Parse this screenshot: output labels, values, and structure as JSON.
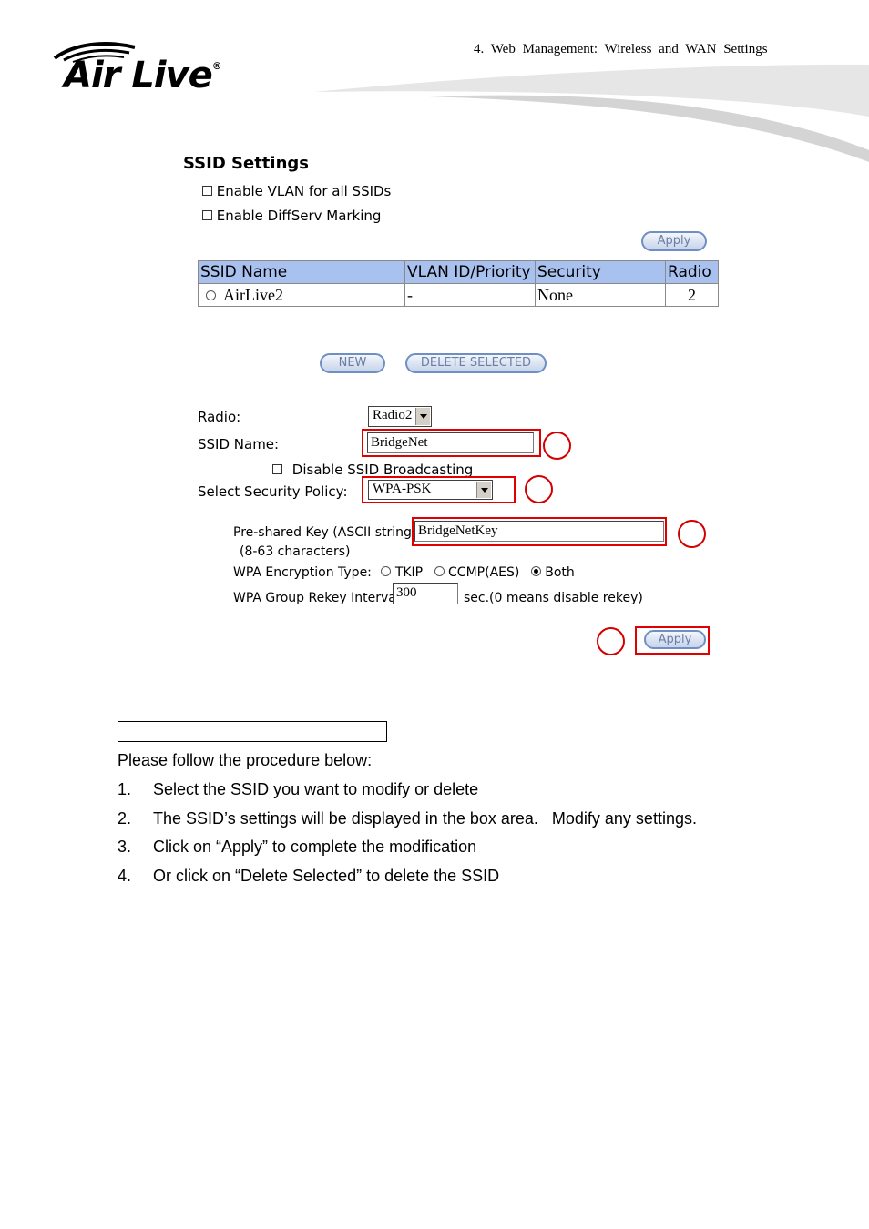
{
  "header": {
    "chapter": "4. Web Management: Wireless and WAN Settings",
    "logo": "Air Live",
    "logo_reg": "®"
  },
  "ssid_settings": {
    "title": "SSID Settings",
    "enable_vlan_label": "Enable VLAN for all SSIDs",
    "enable_diffserv_label": "Enable DiffServ Marking",
    "apply_label": "Apply",
    "table": {
      "headers": [
        "SSID  Name",
        "VLAN ID/Priority",
        "Security",
        "Radio"
      ],
      "rows": [
        {
          "name": "AirLive2",
          "vlan": "-",
          "security": "None",
          "radio": "2"
        }
      ]
    },
    "new_label": "NEW",
    "delete_label": "DELETE SELECTED"
  },
  "form": {
    "radio_label": "Radio:",
    "radio_value": "Radio2",
    "ssid_name_label": "SSID Name:",
    "ssid_name_value": "BridgeNet",
    "disable_broadcast_label": "Disable SSID Broadcasting",
    "security_policy_label": "Select Security Policy:",
    "security_policy_value": "WPA-PSK",
    "psk_label": "Pre-shared Key (ASCII string):",
    "psk_hint": "(8-63 characters)",
    "psk_value": "BridgeNetKey",
    "wpa_enc_label": "WPA Encryption Type:",
    "wpa_enc_options": [
      "TKIP",
      "CCMP(AES)",
      "Both"
    ],
    "wpa_enc_selected": "Both",
    "rekey_label": "WPA Group Rekey Interval:",
    "rekey_value": "300",
    "rekey_suffix": "sec.(0 means disable rekey)",
    "apply_label": "Apply"
  },
  "doc": {
    "intro": "Please follow the procedure below:",
    "steps": [
      {
        "num": "1.",
        "text": "Select the SSID you want to modify or delete"
      },
      {
        "num": "2.",
        "text": "The SSID’s settings will be displayed in the box area.   Modify any settings."
      },
      {
        "num": "3.",
        "text": "Click on “Apply” to complete the modification"
      },
      {
        "num": "4.",
        "text": "Or click on “Delete Selected” to delete the SSID"
      }
    ]
  },
  "colors": {
    "highlight": "#e00000",
    "table_header": "#a9c1ef",
    "button_border": "#6f8fc4"
  }
}
